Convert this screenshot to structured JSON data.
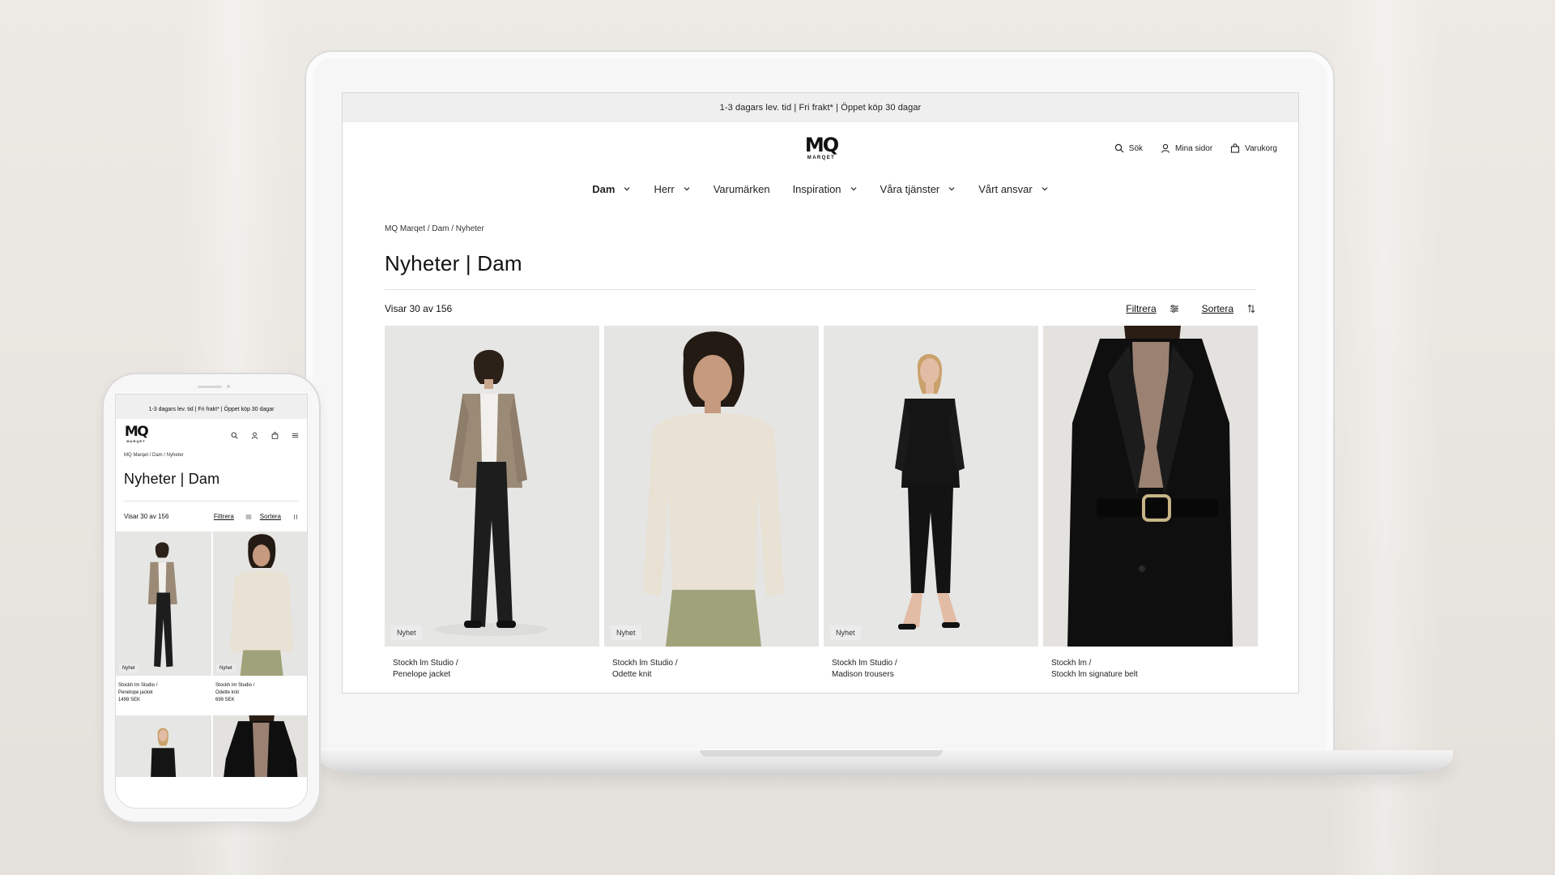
{
  "promo_text": "1-3 dagars lev. tid |  Fri frakt*  | Öppet köp 30 dagar",
  "brand": {
    "mark": "MQ",
    "sub": "MARQET"
  },
  "utilities": [
    {
      "label": "Sök",
      "icon": "search-icon"
    },
    {
      "label": "Mina sidor",
      "icon": "user-icon"
    },
    {
      "label": "Varukorg",
      "icon": "bag-icon"
    }
  ],
  "nav": [
    {
      "label": "Dam",
      "dropdown": true,
      "active": true
    },
    {
      "label": "Herr",
      "dropdown": true
    },
    {
      "label": "Varumärken",
      "dropdown": false
    },
    {
      "label": "Inspiration",
      "dropdown": true
    },
    {
      "label": "Våra tjänster",
      "dropdown": true
    },
    {
      "label": "Vårt ansvar",
      "dropdown": true
    }
  ],
  "breadcrumb": "MQ Marqet / Dam / Nyheter",
  "page_title": "Nyheter | Dam",
  "result_count": "Visar 30 av 156",
  "filter_label": "Filtrera",
  "sort_label": "Sortera",
  "products": [
    {
      "badge": "Nyhet",
      "brand": "Stockh lm Studio /",
      "name": "Penelope jacket",
      "price": "1499 SEK"
    },
    {
      "badge": "Nyhet",
      "brand": "Stockh lm Studio /",
      "name": "Odette knit",
      "price": "699 SEK"
    },
    {
      "badge": "Nyhet",
      "brand": "Stockh lm Studio /",
      "name": "Madison trousers",
      "price": ""
    },
    {
      "badge": "",
      "brand": "Stockh lm /",
      "name": "Stockh lm signature belt",
      "price": ""
    }
  ],
  "colors": {
    "page_bg": "#ece8e3",
    "product_bg": "#e7e7e5",
    "promo_bg": "#efefef"
  }
}
